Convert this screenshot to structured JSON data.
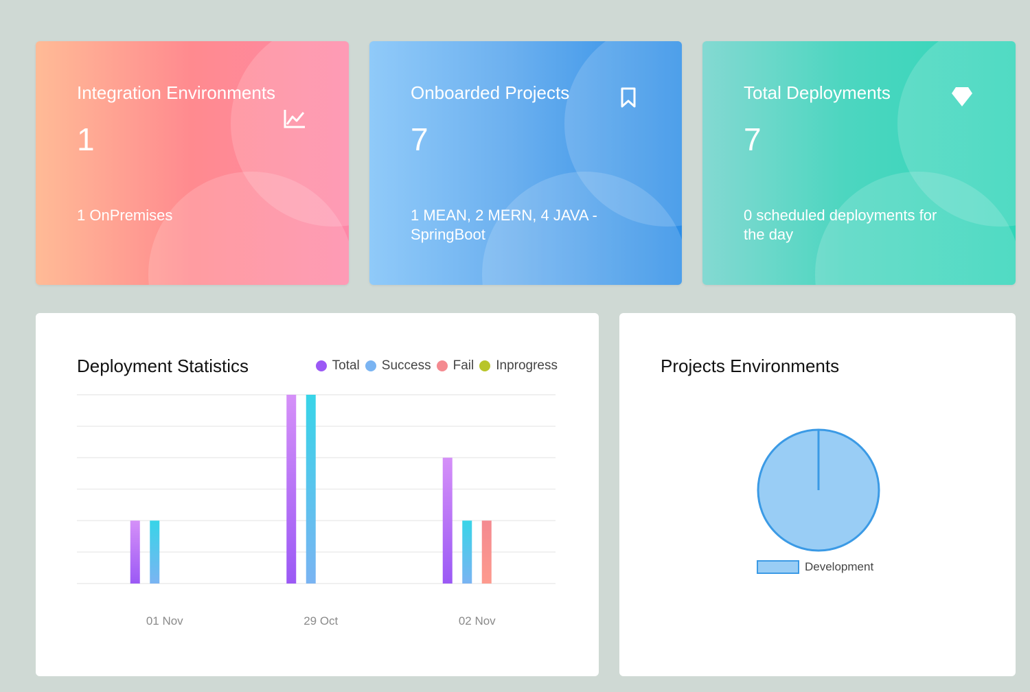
{
  "cards": [
    {
      "title": "Integration Environments",
      "value": "1",
      "sub": "1 OnPremises",
      "icon": "line-chart-icon"
    },
    {
      "title": "Onboarded Projects",
      "value": "7",
      "sub": "1 MEAN, 2 MERN, 4 JAVA - SpringBoot",
      "icon": "bookmark-icon"
    },
    {
      "title": "Total Deployments",
      "value": "7",
      "sub": "0 scheduled deployments for the day",
      "icon": "diamond-icon"
    }
  ],
  "deployment": {
    "title": "Deployment Statistics",
    "legend": [
      {
        "label": "Total",
        "color": "#9b59f5"
      },
      {
        "label": "Success",
        "color": "#7ab4f2"
      },
      {
        "label": "Fail",
        "color": "#f48a90"
      },
      {
        "label": "Inprogress",
        "color": "#b8c52a"
      }
    ]
  },
  "projects_env": {
    "title": "Projects Environments",
    "legend_label": "Development"
  },
  "chart_data": [
    {
      "type": "bar",
      "title": "Deployment Statistics",
      "categories": [
        "01 Nov",
        "29 Oct",
        "02 Nov"
      ],
      "series": [
        {
          "name": "Total",
          "values": [
            2,
            6,
            4
          ]
        },
        {
          "name": "Success",
          "values": [
            2,
            6,
            2
          ]
        },
        {
          "name": "Fail",
          "values": [
            0,
            0,
            2
          ]
        },
        {
          "name": "Inprogress",
          "values": [
            0,
            0,
            0
          ]
        }
      ],
      "ylim": [
        0,
        6
      ],
      "grid": true,
      "legend": "top-right"
    },
    {
      "type": "pie",
      "title": "Projects Environments",
      "categories": [
        "Development"
      ],
      "values": [
        1
      ],
      "legend": "bottom"
    }
  ]
}
